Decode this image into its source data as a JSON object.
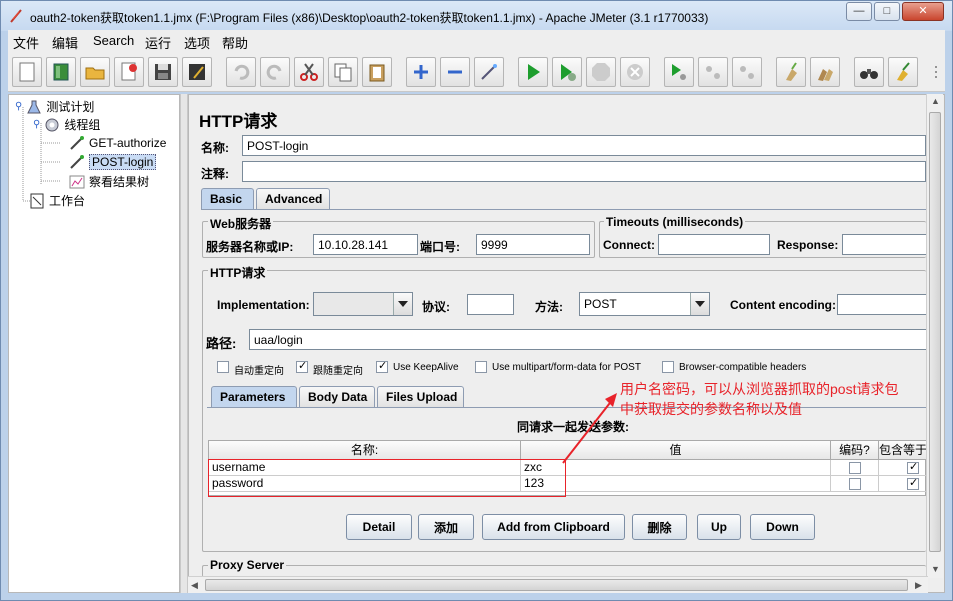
{
  "window": {
    "title": "oauth2-token获取token1.1.jmx (F:\\Program Files (x86)\\Desktop\\oauth2-token获取token1.1.jmx) - Apache JMeter (3.1 r1770033)",
    "minimize": "—",
    "maximize": "□",
    "close": "✕"
  },
  "menu": [
    "文件",
    "编辑",
    "Search",
    "运行",
    "选项",
    "帮助"
  ],
  "tree": {
    "test_plan": "测试计划",
    "thread_group": "线程组",
    "get_authorize": "GET-authorize",
    "post_login": "POST-login",
    "view_results": "察看结果树",
    "workbench": "工作台"
  },
  "panel": {
    "title": "HTTP请求",
    "name_label": "名称:",
    "name_value": "POST-login",
    "comment_label": "注释:",
    "tabs": [
      "Basic",
      "Advanced"
    ],
    "web_server": {
      "title": "Web服务器",
      "server_label": "服务器名称或IP:",
      "server_value": "10.10.28.141",
      "port_label": "端口号:",
      "port_value": "9999"
    },
    "timeouts": {
      "title": "Timeouts (milliseconds)",
      "connect_label": "Connect:",
      "response_label": "Response:"
    },
    "http_request": {
      "title": "HTTP请求",
      "impl_label": "Implementation:",
      "protocol_label": "协议:",
      "method_label": "方法:",
      "method_value": "POST",
      "encoding_label": "Content encoding:",
      "path_label": "路径:",
      "path_value": "uaa/login"
    },
    "options": [
      {
        "label": "自动重定向",
        "checked": false
      },
      {
        "label": "跟随重定向",
        "checked": true
      },
      {
        "label": "Use KeepAlive",
        "checked": true
      },
      {
        "label": "Use multipart/form-data for POST",
        "checked": false
      },
      {
        "label": "Browser-compatible headers",
        "checked": false
      }
    ],
    "param_tabs": [
      "Parameters",
      "Body Data",
      "Files Upload"
    ],
    "params_title": "同请求一起发送参数:",
    "columns": [
      "名称:",
      "值",
      "编码?",
      "包含等于"
    ],
    "rows": [
      {
        "name": "username",
        "value": "zxc",
        "encode": false,
        "include_equals": true
      },
      {
        "name": "password",
        "value": "123",
        "encode": false,
        "include_equals": true
      }
    ],
    "buttons": [
      "Detail",
      "添加",
      "Add from Clipboard",
      "删除",
      "Up",
      "Down"
    ],
    "proxy_title": "Proxy Server"
  },
  "annotation": {
    "line1": "用户名密码，可以从浏览器抓取的post请求包",
    "line2": "中获取提交的参数名称以及值",
    "color": "#e8232a"
  }
}
